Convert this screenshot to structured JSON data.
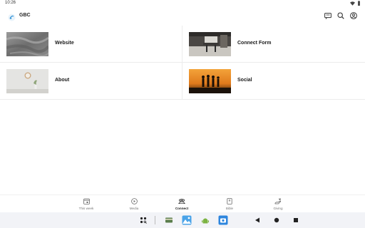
{
  "status": {
    "time": "10:26",
    "wifi_icon": "wifi-icon",
    "battery_icon": "battery-icon"
  },
  "app": {
    "title": "GBC",
    "logo_icon": "gbc-logo-icon",
    "actions": [
      {
        "name": "messages-icon"
      },
      {
        "name": "search-icon"
      },
      {
        "name": "account-icon"
      }
    ]
  },
  "tiles": [
    {
      "label": "Website",
      "image": "textured-surface-photo"
    },
    {
      "label": "Connect Form",
      "image": "chair-photo"
    },
    {
      "label": "About",
      "image": "wall-clock-photo"
    },
    {
      "label": "Social",
      "image": "sunset-silhouettes-photo"
    }
  ],
  "bottom_nav": {
    "items": [
      {
        "label": "This week",
        "icon": "calendar-icon",
        "active": false
      },
      {
        "label": "Media",
        "icon": "play-circle-icon",
        "active": false
      },
      {
        "label": "Connect",
        "icon": "people-icon",
        "active": true
      },
      {
        "label": "Bible",
        "icon": "book-icon",
        "active": false
      },
      {
        "label": "Giving",
        "icon": "giving-hand-icon",
        "active": false
      }
    ]
  },
  "colors": {
    "accent": "#2b8fd6",
    "nav_active": "#222222",
    "nav_inactive": "#777777",
    "system_bar": "#f2f3f7"
  }
}
